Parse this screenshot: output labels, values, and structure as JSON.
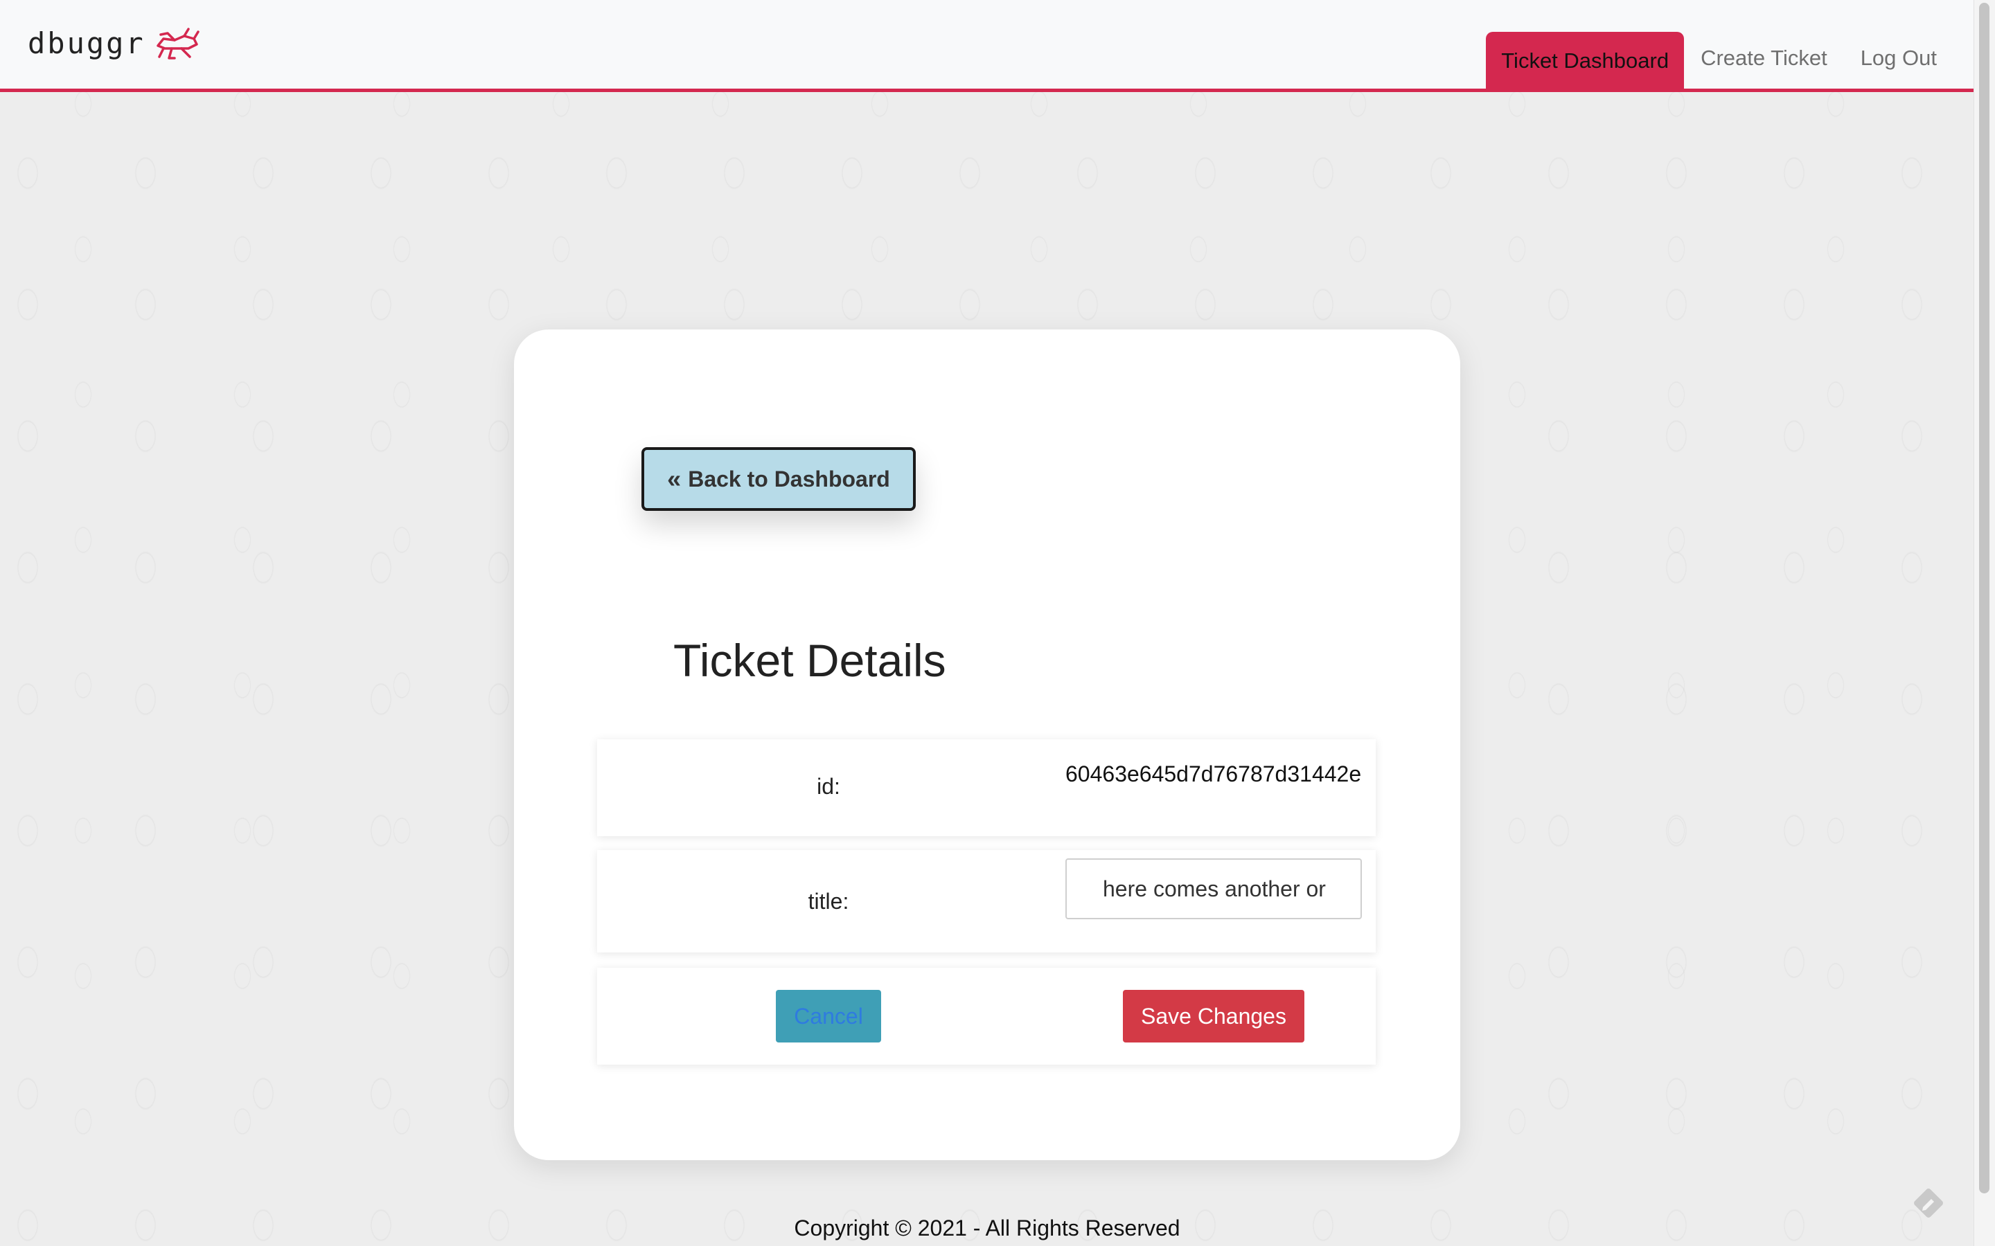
{
  "brand": {
    "name": "dbuggr",
    "logo_icon": "grasshopper-icon",
    "accent_color": "#d4284f"
  },
  "nav": {
    "items": [
      {
        "label": "Ticket Dashboard",
        "active": true
      },
      {
        "label": "Create Ticket",
        "active": false
      },
      {
        "label": "Log Out",
        "active": false
      }
    ]
  },
  "card": {
    "back_button": {
      "label": "Back to Dashboard",
      "icon": "double-chevron-left-icon"
    },
    "title": "Ticket Details",
    "fields": {
      "id": {
        "label": "id:",
        "value": "60463e645d7d76787d31442e"
      },
      "title": {
        "label": "title:",
        "value": "here comes another or"
      }
    },
    "actions": {
      "cancel_label": "Cancel",
      "save_label": "Save Changes"
    }
  },
  "footer": {
    "copyright": "Copyright © 2021 - All Rights Reserved"
  },
  "colors": {
    "cancel_bg": "#3f9fb6",
    "save_bg": "#d33a46",
    "back_bg": "#b7dbe8",
    "background": "#ededed"
  }
}
